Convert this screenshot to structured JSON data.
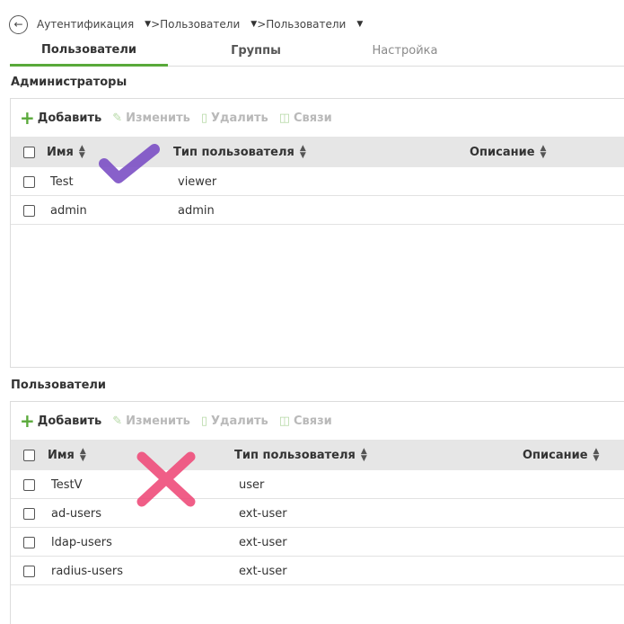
{
  "breadcrumb": {
    "items": [
      {
        "label": "Аутентификация"
      },
      {
        "label": "Пользователи"
      },
      {
        "label": "Пользователи"
      }
    ],
    "separator": ">"
  },
  "tabs": [
    {
      "label": "Пользователи",
      "active": true
    },
    {
      "label": "Группы",
      "active": false
    },
    {
      "label": "Настройка",
      "active": false
    }
  ],
  "toolbar": {
    "add": "Добавить",
    "edit": "Изменить",
    "delete": "Удалить",
    "links": "Связи"
  },
  "admins": {
    "title": "Администраторы",
    "columns": {
      "name": "Имя",
      "type": "Тип пользователя",
      "description": "Описание"
    },
    "rows": [
      {
        "name": "Test",
        "type": "viewer"
      },
      {
        "name": "admin",
        "type": "admin"
      }
    ]
  },
  "users": {
    "title": "Пользователи",
    "columns": {
      "name": "Имя",
      "type": "Тип пользователя",
      "description": "Описание"
    },
    "rows": [
      {
        "name": "TestV",
        "type": "user"
      },
      {
        "name": "ad-users",
        "type": "ext-user"
      },
      {
        "name": "ldap-users",
        "type": "ext-user"
      },
      {
        "name": "radius-users",
        "type": "ext-user"
      }
    ]
  },
  "annotations": {
    "check_color": "#7b4fc4",
    "cross_color": "#ee4d7a",
    "accent_color": "#59a93a"
  }
}
